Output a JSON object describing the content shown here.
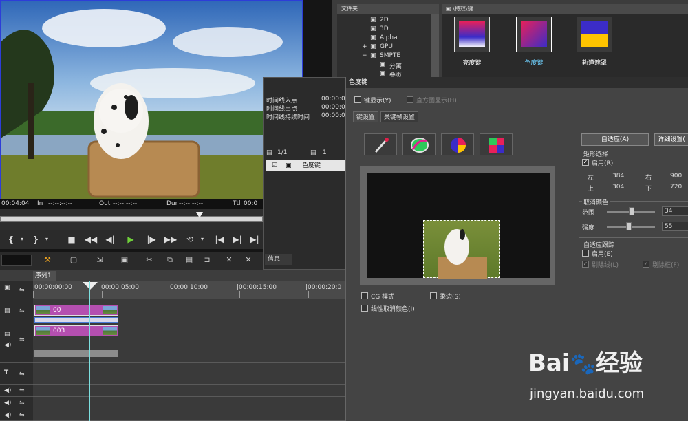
{
  "preview": {
    "timecode": "00:04:04",
    "in_label": "In",
    "in_value": "--:--:--:--",
    "out_label": "Out",
    "out_value": "--:--:--:--",
    "dur_label": "Dur",
    "dur_value": "--:--:--:--",
    "ttl_label": "Ttl",
    "ttl_value": "00:0"
  },
  "scrub": {
    "position_fraction": 0.76
  },
  "timeline": {
    "sequence_tab": "序列1",
    "ruler_labels": [
      "00:00:00:00",
      "|00:00:05:00",
      "|00:00:10:00",
      "|00:00:15:00",
      "|00:00:20:0"
    ],
    "clips": [
      {
        "label": "00"
      },
      {
        "label": "003"
      }
    ]
  },
  "mid_panel": {
    "rows": [
      {
        "label": "时间线入点",
        "value": "00:00:00"
      },
      {
        "label": "时间线出点",
        "value": "00:00:06"
      },
      {
        "label": "时间线持续时间",
        "value": "00:00:06"
      }
    ],
    "page": "1/1",
    "count": "1",
    "effect_item": "色度键",
    "info_tab": "信息"
  },
  "bin": {
    "folder_header": "文件夹",
    "folders": [
      "2D",
      "3D",
      "Alpha",
      "GPU",
      "SMPTE",
      "分离",
      "叠页"
    ],
    "path": "\\特效\\键",
    "effects": [
      {
        "label": "亮度键",
        "color": "#ffffff"
      },
      {
        "label": "色度键",
        "color": "#6fd1ff"
      },
      {
        "label": "轨道遮罩",
        "color": "#ffffff"
      }
    ]
  },
  "dialog": {
    "title": "色度键",
    "key_display": "键显示(Y)",
    "histogram": "直方图显示(H)",
    "tabs": [
      "键设置",
      "关键帧设置"
    ],
    "auto_button": "自适应(A)",
    "detail_button": "详细设置(",
    "rect_group": "矩形选择",
    "rect_enable": "启用(R)",
    "rect": {
      "left_label": "左",
      "left": "384",
      "right_label": "右",
      "right": "900",
      "top_label": "上",
      "top": "304",
      "bottom_label": "下",
      "bottom": "720"
    },
    "cancel_group": "取消颜色",
    "range_label": "范围",
    "range_value": "34",
    "strength_label": "强度",
    "strength_value": "55",
    "track_group": "自适应跟踪",
    "track_enable": "启用(E)",
    "track_line": "剔除线(L)",
    "track_frame": "剔除框(F)",
    "cg_mode": "CG 模式",
    "soft_edge": "柔边(S)",
    "linear_cancel": "线性取消颜色(I)"
  },
  "watermark": {
    "brand": "Bai",
    "brand2": "经验",
    "url": "jingyan.baidu.com"
  }
}
